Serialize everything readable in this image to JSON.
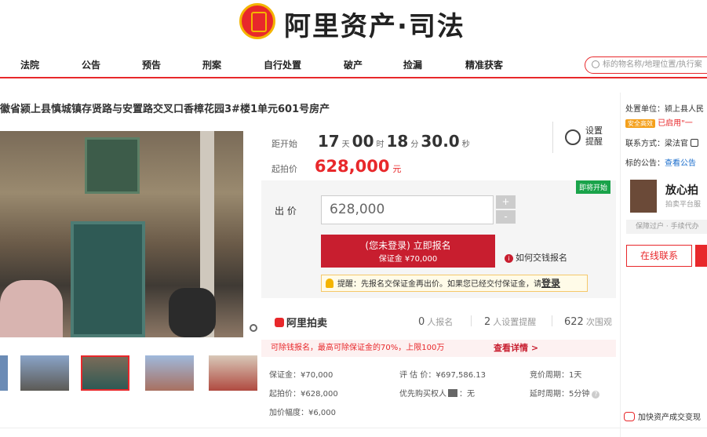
{
  "brand": {
    "name": "阿里资产·司法"
  },
  "nav": {
    "items": [
      "法院",
      "公告",
      "预告",
      "刑案",
      "自行处置",
      "破产",
      "捡漏",
      "精准获客"
    ],
    "search_placeholder": "标的物名称/地理位置/执行案"
  },
  "item": {
    "title": "徽省颍上县慎城镇存贤路与安置路交叉口香樟花园3#楼1单元601号房产"
  },
  "countdown": {
    "label": "距开始",
    "days": "17",
    "days_unit": "天",
    "hours": "00",
    "hours_unit": "时",
    "minutes": "18",
    "minutes_unit": "分",
    "seconds": "30.0",
    "seconds_unit": "秒"
  },
  "start_price": {
    "label": "起拍价",
    "value": "628,000",
    "unit": "元"
  },
  "reminder": {
    "label": "设置提醒"
  },
  "bid": {
    "badge": "即将开始",
    "label": "出 价",
    "value": "628,000",
    "plus": "+",
    "minus": "-",
    "register_main": "(您未登录) 立即报名",
    "register_sub": "保证金 ¥70,000",
    "how_pay": "如何交钱报名",
    "tip_text": "提醒：先报名交保证金再出价。如果您已经交付保证金，请",
    "tip_link": "登录"
  },
  "stats": {
    "platform": "阿里拍卖",
    "signup_count": "0",
    "signup_label": "人报名",
    "remind_count": "2",
    "remind_label": "人设置提醒",
    "view_count": "622",
    "view_label": "次围观"
  },
  "promo": {
    "text": "可除钱报名，最高可除保证金的70%，上限100万",
    "link": "查看详情 >"
  },
  "details": {
    "deposit": "保证金：¥70,000",
    "estimate": "评 估 价：¥697,586.13",
    "cycle": "竞价周期：1天",
    "start": "起拍价：¥628,000",
    "priority": "优先购买权人",
    "priority_value": "：无",
    "delay": "延时周期：5分钟",
    "increment": "加价幅度：¥6,000"
  },
  "side": {
    "unit": "处置单位：颍上县人民",
    "safe_badge": "安全高效",
    "enabled": "已启用\"一",
    "contact": "联系方式：梁法官",
    "announce_label": "标的公告：",
    "announce_link": "查看公告",
    "assure_title": "放心拍",
    "assure_sub": "拍卖平台服",
    "assure_bar": "保障过户 · 手续代办",
    "online": "在线联系",
    "speedup": "加快资产成交变现"
  },
  "colors": {
    "accent": "#e8282b",
    "button": "#c81e2f",
    "badge": "#1aa34a"
  }
}
